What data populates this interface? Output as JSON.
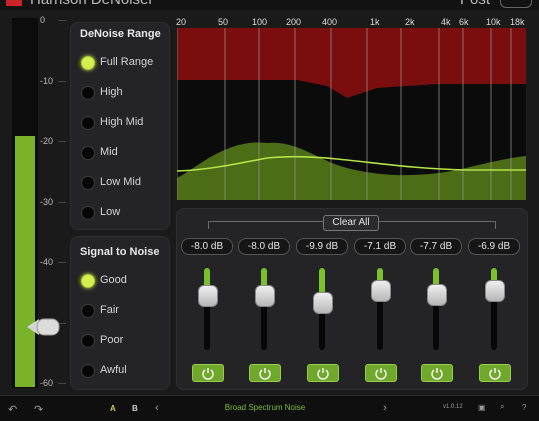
{
  "app": {
    "title": "Harrison DeNoiser",
    "preset_label": "Post"
  },
  "meter": {
    "ticks": [
      "0",
      "-10",
      "-20",
      "-30",
      "-40",
      "-50",
      "-60"
    ],
    "level_db": -19,
    "threshold_db": -49
  },
  "denoise_range": {
    "title": "DeNoise Range",
    "options": [
      "Full Range",
      "High",
      "High Mid",
      "Mid",
      "Low Mid",
      "Low"
    ],
    "selected": "Full Range"
  },
  "signal_to_noise": {
    "title": "Signal to Noise",
    "options": [
      "Good",
      "Fair",
      "Poor",
      "Awful"
    ],
    "selected": "Good"
  },
  "graph": {
    "freq_labels": [
      "20",
      "50",
      "100",
      "200",
      "400",
      "1k",
      "2k",
      "4k",
      "6k",
      "10k",
      "18k"
    ],
    "colors": {
      "noise": "#7a0d0d",
      "signal": "#4c6d16",
      "curve": "#b6e24a"
    }
  },
  "bands": {
    "clear_all_label": "Clear All",
    "items": [
      {
        "db": "-8.0 dB",
        "level": 0.74
      },
      {
        "db": "-8.0 dB",
        "level": 0.74
      },
      {
        "db": "-9.9 dB",
        "level": 0.66
      },
      {
        "db": "-7.1 dB",
        "level": 0.8
      },
      {
        "db": "-7.7 dB",
        "level": 0.76
      },
      {
        "db": "-6.9 dB",
        "level": 0.81
      }
    ]
  },
  "footer": {
    "a_label": "A",
    "b_label": "B",
    "preset_name": "Broad Spectrum Noise",
    "version": "v1.0.12"
  },
  "colors": {
    "accent": "#7ab32a",
    "brand": "#c8242a"
  }
}
